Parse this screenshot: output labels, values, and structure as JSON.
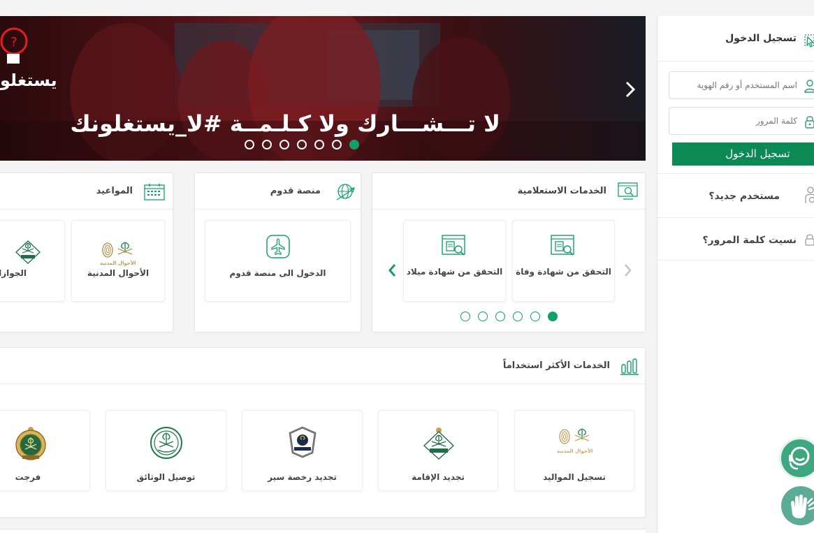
{
  "banner": {
    "slogan": "لا تـــشـــارك ولا كـلـمــة #لا_يستغلونك",
    "logo_text": "يستغلو",
    "slide_count": 7,
    "active_slide": 7
  },
  "login": {
    "title": "تسجيل الدخول",
    "username_placeholder": "اسم المستخدم أو رقم الهوية",
    "password_placeholder": "كلمة المرور",
    "submit_label": "تسجيل الدخول",
    "new_user_label": "مستخدم جديد؟",
    "forgot_label": "نسيت كلمة المرور؟"
  },
  "inquiry": {
    "title": "الخدمات الاستعلامية",
    "tiles": [
      {
        "label": "التحقق من شهادة وفاة"
      },
      {
        "label": "التحقق من شهادة ميلاد"
      }
    ],
    "page_count": 6,
    "active_page": 1
  },
  "qudoom": {
    "title": "منصة قدوم",
    "tiles": [
      {
        "label": "الدخول الى منصة قدوم"
      }
    ]
  },
  "appointments": {
    "title": "المواعيد",
    "tiles": [
      {
        "label": "الأحوال المدنية",
        "logo_caption": "الأحوال المدنية"
      },
      {
        "label": "الجوازات"
      }
    ]
  },
  "most_used": {
    "title": "الخدمات الأكثر استخداماً",
    "tiles": [
      {
        "label": "تسجيل المواليد",
        "logo_caption": "الأحوال المدنية"
      },
      {
        "label": "تجديد الإقامة"
      },
      {
        "label": "تجديد رخصة سير"
      },
      {
        "label": "توصيل الوثائق"
      },
      {
        "label": "فرجت"
      }
    ]
  },
  "colors": {
    "brand_green": "#12a06a",
    "button_green": "#0c8a55",
    "support_teal": "#3da77f",
    "sign_teal": "#5cab97"
  },
  "icons": {
    "login": "pointer-click-icon",
    "user": "user-icon",
    "lock": "lock-icon",
    "new_user": "add-user-icon",
    "inquiry": "search-screen-icon",
    "qudoom": "globe-plane-icon",
    "appointments": "calendar-icon",
    "most_used": "bar-chart-icon",
    "support": "headset-support-icon",
    "sign_language": "sign-language-icon"
  }
}
